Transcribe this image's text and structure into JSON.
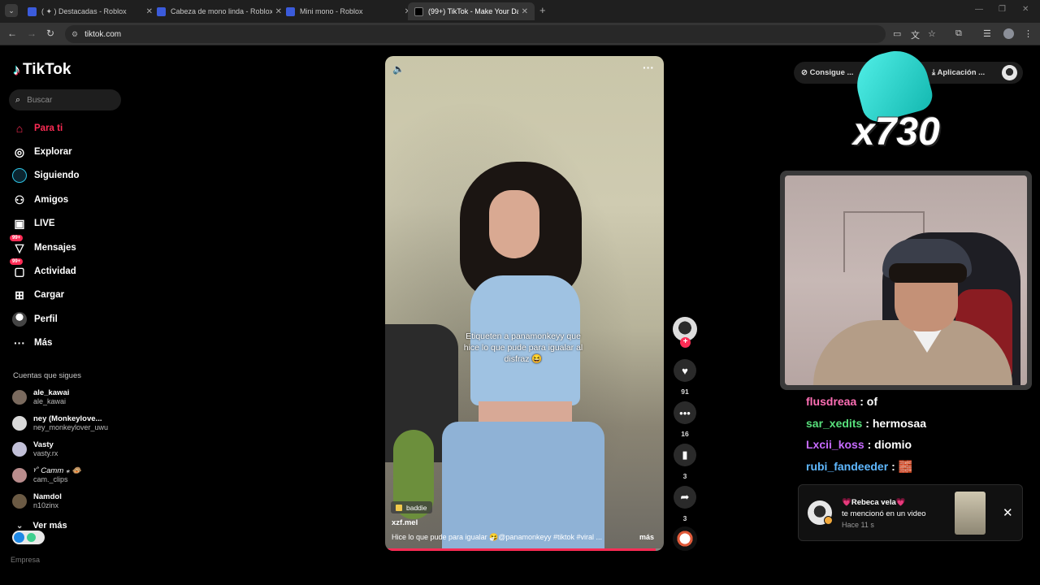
{
  "browser": {
    "tabs": [
      {
        "title": "( ✦ ) Destacadas - Roblox",
        "active": false
      },
      {
        "title": "Cabeza de mono linda - Roblox",
        "active": false
      },
      {
        "title": "Mini mono - Roblox",
        "active": false
      },
      {
        "title": "(99+) TikTok - Make Your Day",
        "active": true
      }
    ],
    "url": "tiktok.com"
  },
  "sidebar": {
    "logo": "TikTok",
    "search_placeholder": "Buscar",
    "nav": [
      {
        "label": "Para ti",
        "icon": "home-icon",
        "active": true
      },
      {
        "label": "Explorar",
        "icon": "compass-icon"
      },
      {
        "label": "Siguiendo",
        "icon": "following-icon"
      },
      {
        "label": "Amigos",
        "icon": "friends-icon"
      },
      {
        "label": "LIVE",
        "icon": "live-icon"
      },
      {
        "label": "Mensajes",
        "icon": "messages-icon",
        "badge": "99+"
      },
      {
        "label": "Actividad",
        "icon": "activity-icon",
        "badge": "99+"
      },
      {
        "label": "Cargar",
        "icon": "upload-icon"
      },
      {
        "label": "Perfil",
        "icon": "profile-icon"
      },
      {
        "label": "Más",
        "icon": "more-icon"
      }
    ],
    "following_title": "Cuentas que sigues",
    "accounts": [
      {
        "name": "ale_kawai",
        "handle": "ale_kawai"
      },
      {
        "name": "ney (Monkeylove...",
        "handle": "ney_monkeylover_uwu"
      },
      {
        "name": "Vasty",
        "handle": "vasty.rx"
      },
      {
        "name": "ᵞ˚ Camm ⁎ 🐵",
        "handle": "cam._clips"
      },
      {
        "name": "Namdol",
        "handle": "n10zinx"
      }
    ],
    "see_more": "Ver más",
    "cut_text": "Empresa"
  },
  "video": {
    "overlay_text": "Etiqueten a panamonkeyy que hice lo que pude para igualar al disfraz 😆",
    "tag": "baddie",
    "username": "xzf.mel",
    "description": "Hice lo que pude para igualar 🤧@panamonkeyy #tiktok #viral ...",
    "more": "más",
    "progress": 0.97
  },
  "actions": {
    "likes": "91",
    "comments": "16",
    "saves": "3",
    "shares": "3"
  },
  "topbar": {
    "coins": "Consigue ...",
    "app": "Aplicación ..."
  },
  "stream_overlay": {
    "multiplier": "x730"
  },
  "chat": [
    {
      "user": "flusdreaa",
      "message": ": of",
      "color": "#ff6fb5"
    },
    {
      "user": "sar_xedits",
      "message": ": hermosaa",
      "color": "#58e07c"
    },
    {
      "user": "Lxcii_koss",
      "message": ": diomio",
      "color": "#c76bff"
    },
    {
      "user": "rubi_fandeeder",
      "message": ": 🧱",
      "color": "#5fb8ff"
    }
  ],
  "notification": {
    "name": "💗Rebeca vela💗",
    "message": "te mencionó en un video",
    "time": "Hace 11 s"
  }
}
